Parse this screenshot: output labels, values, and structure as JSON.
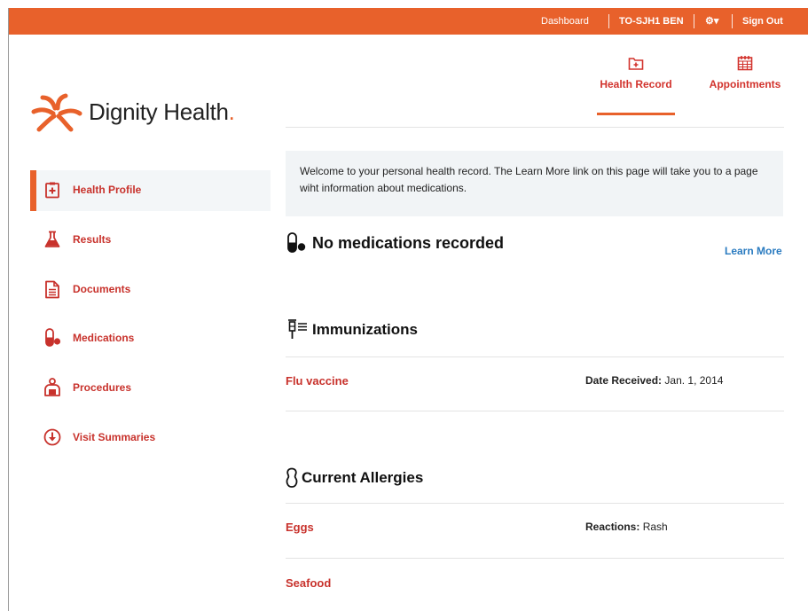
{
  "topbar": {
    "dashboard": "Dashboard",
    "account": "TO-SJH1 BEN",
    "settings": "⚙▾",
    "sign_out": "Sign Out"
  },
  "brand": {
    "name": "Dignity Health",
    "dot": ".",
    "accent": "#e8612b",
    "link_red": "#c8322c"
  },
  "top_nav": {
    "health_record": "Health Record",
    "appointments": "Appointments"
  },
  "sidebar": {
    "items": [
      {
        "label": "Health Profile",
        "icon": "health-profile-icon",
        "active": true
      },
      {
        "label": "Results",
        "icon": "flask-icon"
      },
      {
        "label": "Documents",
        "icon": "document-icon"
      },
      {
        "label": "Medications",
        "icon": "pill-icon"
      },
      {
        "label": "Procedures",
        "icon": "procedures-icon"
      },
      {
        "label": "Visit Summaries",
        "icon": "download-circle-icon"
      }
    ]
  },
  "welcome": {
    "text": "Welcome to your personal health record. The Learn More link on this page will take you to a page wiht information about medications."
  },
  "medications": {
    "title": "No medications recorded",
    "learn_more": "Learn More"
  },
  "immunizations": {
    "title": "Immunizations",
    "rows": [
      {
        "name": "Flu vaccine",
        "detail_label": "Date Received:",
        "detail_value": "Jan. 1, 2014"
      }
    ]
  },
  "allergies": {
    "title": "Current Allergies",
    "rows": [
      {
        "name": "Eggs",
        "detail_label": "Reactions:",
        "detail_value": "Rash"
      },
      {
        "name": "Seafood"
      }
    ]
  }
}
